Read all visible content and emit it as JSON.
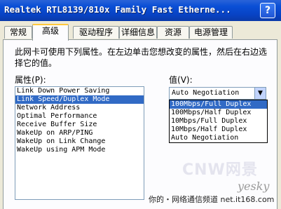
{
  "window": {
    "title": "Realtek RTL8139/810x Family Fast Etherne...",
    "help_label": "?"
  },
  "tabs": [
    {
      "label": "常规"
    },
    {
      "label": "高级"
    },
    {
      "label": "驱动程序"
    },
    {
      "label": "详细信息"
    },
    {
      "label": "资源"
    },
    {
      "label": "电源管理"
    }
  ],
  "panel": {
    "description": "此网卡可使用下列属性。在左边单击您想改变的属性，然后在右边选择它的值。",
    "property_label": "属性",
    "property_accel": "(P):",
    "value_label": "值",
    "value_accel": "(V):"
  },
  "properties": [
    "Link Down Power Saving",
    "Link Speed/Duplex Mode",
    "Network Address",
    "Optimal Performance",
    "Receive Buffer Size",
    "WakeUp on ARP/PING",
    "WakeUp on Link Change",
    "WakeUp using APM Mode"
  ],
  "value_combo": {
    "selected": "Auto Negotiation",
    "options": [
      "100Mbps/Full Duplex",
      "100Mbps/Half Duplex",
      "10Mbps/Full Duplex",
      "10Mbps/Half Duplex",
      "Auto Negotiation"
    ]
  },
  "watermark": {
    "logo": "yesky",
    "cnw": "CNW网景",
    "text": "你的・网络通信频道  net.it168.com"
  }
}
